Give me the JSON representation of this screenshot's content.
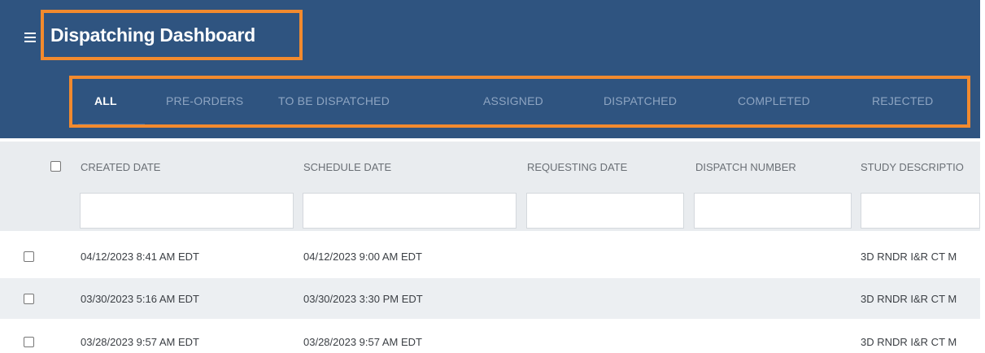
{
  "header": {
    "title": "Dispatching Dashboard"
  },
  "tabs": [
    {
      "label": "ALL",
      "active": true
    },
    {
      "label": "PRE-ORDERS",
      "active": false
    },
    {
      "label": "TO BE DISPATCHED",
      "active": false
    },
    {
      "label": "ASSIGNED",
      "active": false
    },
    {
      "label": "DISPATCHED",
      "active": false
    },
    {
      "label": "COMPLETED",
      "active": false
    },
    {
      "label": "REJECTED",
      "active": false
    }
  ],
  "table": {
    "columns": [
      "CREATED DATE",
      "SCHEDULE DATE",
      "REQUESTING DATE",
      "DISPATCH NUMBER",
      "STUDY DESCRIPTIO"
    ],
    "filters": [
      "",
      "",
      "",
      "",
      ""
    ],
    "rows": [
      {
        "created": "04/12/2023 8:41 AM EDT",
        "schedule": "04/12/2023 9:00 AM EDT",
        "requesting": "",
        "dispatch": "",
        "study": "3D RNDR I&R CT M"
      },
      {
        "created": "03/30/2023 5:16 AM EDT",
        "schedule": "03/30/2023 3:30 PM EDT",
        "requesting": "",
        "dispatch": "",
        "study": "3D RNDR I&R CT M"
      },
      {
        "created": "03/28/2023 9:57 AM EDT",
        "schedule": "03/28/2023 9:57 AM EDT",
        "requesting": "",
        "dispatch": "",
        "study": "3D RNDR I&R CT M"
      }
    ]
  },
  "colors": {
    "header_bg": "#2f5480",
    "highlight": "#f28a2e",
    "active_tab": "#ffffff",
    "inactive_tab": "#8ea5c2"
  },
  "icons": {
    "menu": "hamburger-menu-icon"
  }
}
